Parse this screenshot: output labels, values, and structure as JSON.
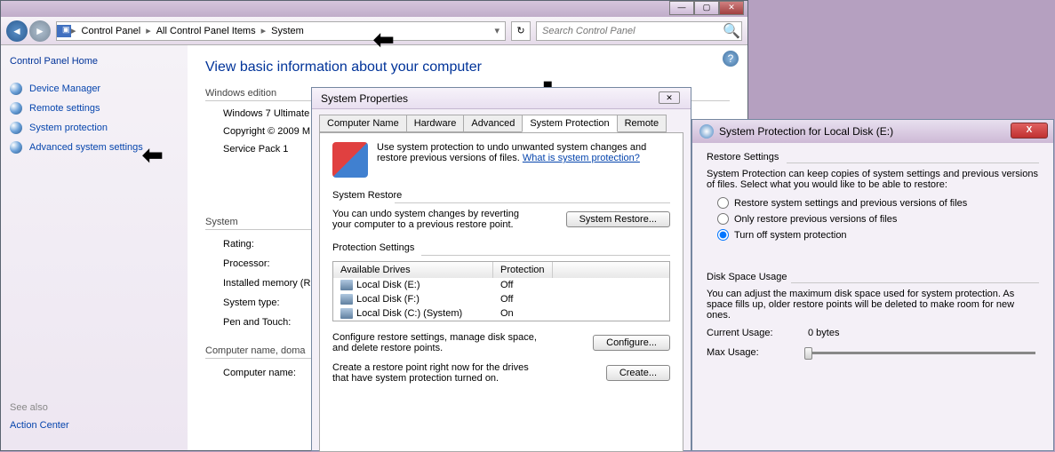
{
  "cp": {
    "breadcrumb": [
      "Control Panel",
      "All Control Panel Items",
      "System"
    ],
    "search_placeholder": "Search Control Panel",
    "home": "Control Panel Home",
    "links": [
      "Device Manager",
      "Remote settings",
      "System protection",
      "Advanced system settings"
    ],
    "see_also_label": "See also",
    "see_also_links": [
      "Action Center"
    ],
    "heading": "View basic information about your computer",
    "sections": {
      "edition_label": "Windows edition",
      "edition_name": "Windows 7 Ultimate",
      "copyright": "Copyright © 2009 M",
      "service_pack": "Service Pack 1",
      "system_label": "System",
      "rating": "Rating:",
      "processor": "Processor:",
      "memory": "Installed memory (R",
      "system_type": "System type:",
      "pen_touch": "Pen and Touch:",
      "domain_label": "Computer name, doma",
      "computer_name": "Computer name:"
    }
  },
  "sp": {
    "title": "System Properties",
    "tabs": [
      "Computer Name",
      "Hardware",
      "Advanced",
      "System Protection",
      "Remote"
    ],
    "intro_text": "Use system protection to undo unwanted system changes and restore previous versions of files.",
    "intro_link": "What is system protection?",
    "restore_title": "System Restore",
    "restore_text": "You can undo system changes by reverting your computer to a previous restore point.",
    "restore_btn": "System Restore...",
    "protection_title": "Protection Settings",
    "drives_header": {
      "c1": "Available Drives",
      "c2": "Protection"
    },
    "drives": [
      {
        "name": "Local Disk (E:)",
        "prot": "Off"
      },
      {
        "name": "Local Disk (F:)",
        "prot": "Off"
      },
      {
        "name": "Local Disk (C:) (System)",
        "prot": "On"
      }
    ],
    "configure_text": "Configure restore settings, manage disk space, and delete restore points.",
    "configure_btn": "Configure...",
    "create_text": "Create a restore point right now for the drives that have system protection turned on.",
    "create_btn": "Create..."
  },
  "spd": {
    "title": "System Protection for Local Disk (E:)",
    "restore_settings_title": "Restore Settings",
    "restore_settings_text": "System Protection can keep copies of system settings and previous versions of files. Select what you would like to be able to restore:",
    "radio1": "Restore system settings and previous versions of files",
    "radio2": "Only restore previous versions of files",
    "radio3": "Turn off system protection",
    "disk_usage_title": "Disk Space Usage",
    "disk_usage_text": "You can adjust the maximum disk space used for system protection. As space fills up, older restore points will be deleted to make room for new ones.",
    "current_label": "Current Usage:",
    "current_value": "0 bytes",
    "max_label": "Max Usage:"
  }
}
